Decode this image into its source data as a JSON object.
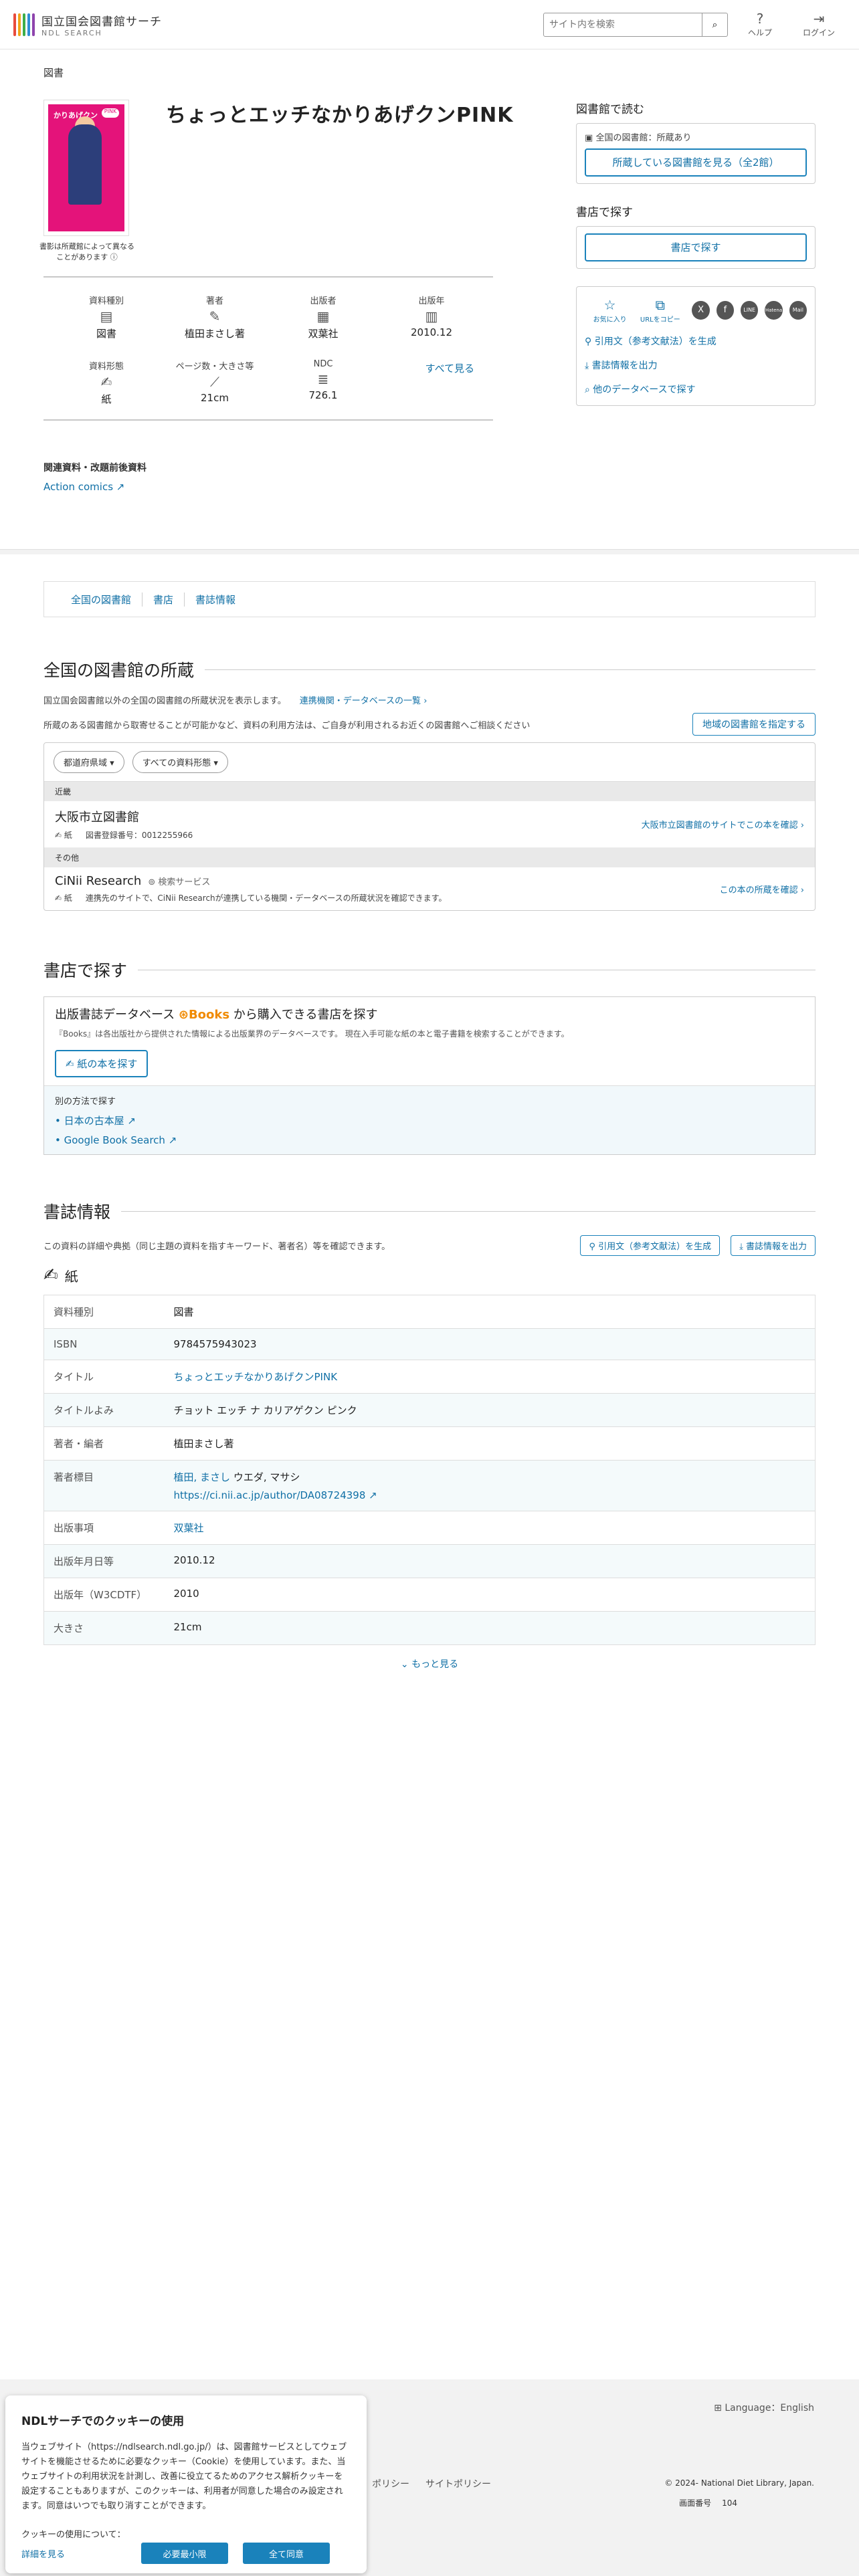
{
  "header": {
    "logo_jp": "国立国会図書館サーチ",
    "logo_en": "NDL SEARCH",
    "search_placeholder": "サイト内を検索",
    "help": "ヘルプ",
    "login": "ログイン"
  },
  "breadcrumb": "図書",
  "book": {
    "title": "ちょっとエッチなかりあげクンPINK",
    "cover_note": "書影は所蔵館によって異なることがあります",
    "meta": [
      {
        "label": "資料種別",
        "value": "図書",
        "icon": "book-icon"
      },
      {
        "label": "著者",
        "value": "植田まさし著",
        "icon": "pen-icon"
      },
      {
        "label": "出版者",
        "value": "双葉社",
        "icon": "building-icon"
      },
      {
        "label": "出版年",
        "value": "2010.12",
        "icon": "calendar-icon"
      },
      {
        "label": "資料形態",
        "value": "紙",
        "icon": "paper-icon"
      },
      {
        "label": "ページ数・大きさ等",
        "value": "21cm",
        "icon": "ruler-icon"
      },
      {
        "label": "NDC",
        "value": "726.1",
        "icon": "list-icon"
      }
    ],
    "see_all": "すべて見る"
  },
  "side": {
    "library_heading": "図書館で読む",
    "library_status": "全国の図書館：所蔵あり",
    "library_button": "所蔵している図書館を見る（全2館）",
    "store_heading": "書店で探す",
    "store_button": "書店で探す",
    "favorite": "お気に入り",
    "copy_url": "URLをコピー",
    "sns": [
      "X",
      "f",
      "LINE",
      "Hatena",
      "Mail"
    ],
    "cite": "引用文（参考文献法）を生成",
    "export": "書誌情報を出力",
    "other_db": "他のデータベースで探す"
  },
  "related": {
    "heading": "関連資料・改題前後資料",
    "link": "Action comics"
  },
  "tabs": [
    "全国の図書館",
    "書店",
    "書誌情報"
  ],
  "holdings": {
    "title": "全国の図書館の所蔵",
    "desc": "国立国会図書館以外の全国の図書館の所蔵状況を表示します。",
    "desc_link": "連携機関・データベースの一覧",
    "desc2": "所蔵のある図書館から取寄せることが可能かなど、資料の利用方法は、ご自身が利用されるお近くの図書館へご相談ください",
    "area_button": "地域の図書館を指定する",
    "filters": [
      "都道府県域",
      "すべての資料形態"
    ],
    "groups": [
      {
        "label": "近畿",
        "items": [
          {
            "name": "大阪市立図書館",
            "tag": "",
            "type": "紙",
            "sub": "図書登録番号：0012255966",
            "action": "大阪市立図書館のサイトでこの本を確認"
          }
        ]
      },
      {
        "label": "その他",
        "items": [
          {
            "name": "CiNii Research",
            "tag": "検索サービス",
            "type": "紙",
            "sub": "連携先のサイトで、CiNii Researchが連携している機関・データベースの所蔵状況を確認できます。",
            "action": "この本の所蔵を確認"
          }
        ]
      }
    ]
  },
  "stores": {
    "title": "書店で探す",
    "db_title_pre": "出版書誌データベース",
    "db_brand": "Books",
    "db_title_post": "から購入できる書店を探す",
    "db_desc": "『Books』は各出版社から提供された情報による出版業界のデータベースです。 現在入手可能な紙の本と電子書籍を検索することができます。",
    "button": "紙の本を探す",
    "alt_label": "別の方法で探す",
    "alt_links": [
      "日本の古本屋",
      "Google Book Search"
    ]
  },
  "bib": {
    "title": "書誌情報",
    "desc": "この資料の詳細や典拠（同じ主題の資料を指すキーワード、著者名）等を確認できます。",
    "cite_button": "引用文（参考文献法）を生成",
    "export_button": "書誌情報を出力",
    "form": "紙",
    "rows": [
      {
        "k": "資料種別",
        "v": "図書",
        "link": false
      },
      {
        "k": "ISBN",
        "v": "9784575943023",
        "link": false
      },
      {
        "k": "タイトル",
        "v": "ちょっとエッチなかりあげクンPINK",
        "link": true
      },
      {
        "k": "タイトルよみ",
        "v": "チョット エッチ ナ カリアゲクン ピンク",
        "link": false
      },
      {
        "k": "著者・編者",
        "v": "植田まさし著",
        "link": false
      },
      {
        "k": "著者標目",
        "v": "植田, まさし",
        "v2": "ウエダ, マサシ",
        "v3": "https://ci.nii.ac.jp/author/DA08724398",
        "link": true
      },
      {
        "k": "出版事項",
        "v": "双葉社",
        "link": true
      },
      {
        "k": "出版年月日等",
        "v": "2010.12",
        "link": false
      },
      {
        "k": "出版年（W3CDTF）",
        "v": "2010",
        "link": false
      },
      {
        "k": "大きさ",
        "v": "21cm",
        "link": false
      }
    ],
    "more": "もっと見る"
  },
  "footer": {
    "language": "Language：English",
    "links": [
      "ポリシー",
      "サイトポリシー"
    ],
    "copyright": "© 2024- National Diet Library, Japan.",
    "page_label": "画面番号",
    "page_no": "104"
  },
  "cookie": {
    "title": "NDLサーチでのクッキーの使用",
    "body": "当ウェブサイト（https://ndlsearch.ndl.go.jp/）は、図書館サービスとしてウェブサイトを機能させるために必要なクッキー（Cookie）を使用しています。また、当ウェブサイトの利用状況を計測し、改善に役立てるためのアクセス解析クッキーを設定することもありますが、このクッキーは、利用者が同意した場合のみ設定されます。同意はいつでも取り消すことができます。",
    "question": "クッキーの使用について：",
    "details": "詳細を見る",
    "necessary": "必要最小限",
    "accept": "全て同意"
  }
}
